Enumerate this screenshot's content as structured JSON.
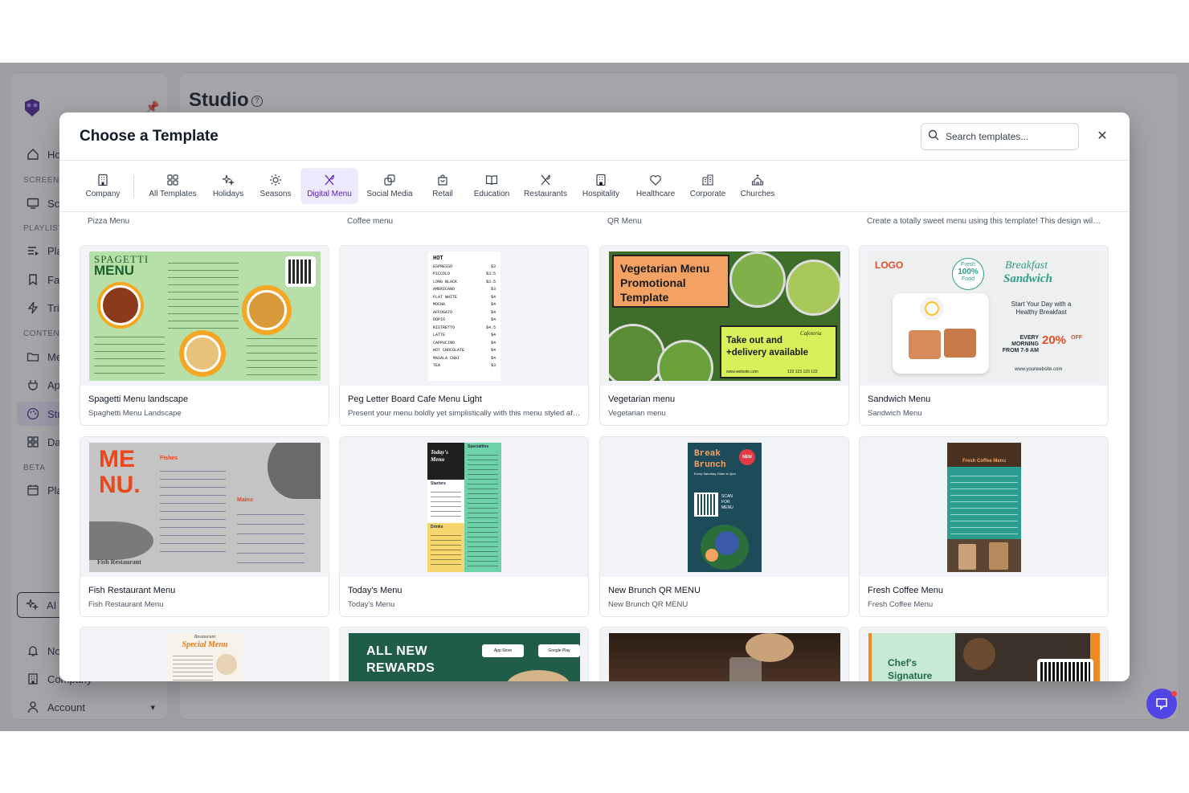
{
  "app": {
    "main_title": "Studio",
    "sidebar": {
      "items": [
        {
          "label": "Home",
          "icon": "home-icon"
        },
        {
          "label": "Screens",
          "icon": "monitor-icon"
        },
        {
          "label": "Playlists",
          "icon": "playlist-icon"
        },
        {
          "label": "Fallback",
          "icon": "bookmark-icon"
        },
        {
          "label": "Triggers",
          "icon": "bolt-icon"
        },
        {
          "label": "Media",
          "icon": "folder-icon"
        },
        {
          "label": "Apps",
          "icon": "plug-icon"
        },
        {
          "label": "Studio",
          "icon": "palette-icon"
        },
        {
          "label": "Dashboards",
          "icon": "grid-icon"
        },
        {
          "label": "Planner",
          "icon": "calendar-icon"
        }
      ],
      "sections": [
        "SCREENS",
        "PLAYLISTS",
        "CONTENT",
        "BETA"
      ],
      "ai_label": "AI",
      "bottom": [
        {
          "label": "Notifications",
          "icon": "bell-icon"
        },
        {
          "label": "Company",
          "icon": "building-icon"
        },
        {
          "label": "Account",
          "icon": "user-icon"
        }
      ]
    }
  },
  "modal": {
    "title": "Choose a Template",
    "search_placeholder": "Search templates...",
    "close_icon": "close-icon",
    "tabs": [
      {
        "label": "Company",
        "icon": "building-icon"
      },
      {
        "label": "All Templates",
        "icon": "grid-icon"
      },
      {
        "label": "Holidays",
        "icon": "sparkles-icon"
      },
      {
        "label": "Seasons",
        "icon": "sun-icon"
      },
      {
        "label": "Digital Menu",
        "icon": "utensils-icon",
        "active": true
      },
      {
        "label": "Social Media",
        "icon": "share-icon"
      },
      {
        "label": "Retail",
        "icon": "shopping-bag-icon"
      },
      {
        "label": "Education",
        "icon": "book-icon"
      },
      {
        "label": "Restaurants",
        "icon": "utensils-icon"
      },
      {
        "label": "Hospitality",
        "icon": "hotel-icon"
      },
      {
        "label": "Healthcare",
        "icon": "heart-icon"
      },
      {
        "label": "Corporate",
        "icon": "office-icon"
      },
      {
        "label": "Churches",
        "icon": "church-icon"
      }
    ],
    "stub_row": [
      "Pizza Menu",
      "Coffee menu",
      "QR Menu",
      "Create a totally sweet menu using this template! This design will bri..."
    ],
    "cards": [
      {
        "title": "Spagetti Menu landscape",
        "subtitle": "Spaghetti Menu Landscape",
        "thumb": {
          "heading1": "SPAGETTI",
          "heading2": "MENU"
        }
      },
      {
        "title": "Peg Letter Board Cafe Menu Light",
        "subtitle": "Present your menu boldly yet simplistically with this menu styled aft...",
        "thumb": {
          "heading": "HOT",
          "items": [
            [
              "ESPRESSO",
              "$3"
            ],
            [
              "PICCOLO",
              "$3.5"
            ],
            [
              "LONG BLACK",
              "$3.5"
            ],
            [
              "AMERICANO",
              "$3"
            ],
            [
              "FLAT WHITE",
              "$4"
            ],
            [
              "MOCHA",
              "$4"
            ],
            [
              "AFFOGATO",
              "$4"
            ],
            [
              "DOPIO",
              "$4"
            ],
            [
              "RISTRETTO",
              "$4.5"
            ],
            [
              "LATTE",
              "$4"
            ],
            [
              "CAPPUCINO",
              "$4"
            ],
            [
              "HOT CHOCOLATE",
              "$4"
            ],
            [
              "MASALA CHAI",
              "$4"
            ],
            [
              "TEA",
              "$3"
            ]
          ]
        }
      },
      {
        "title": "Vegetarian menu",
        "subtitle": "Vegetarian menu",
        "thumb": {
          "heading": "Vegetarian Menu Promotional Template",
          "promo": "Take out and +delivery available",
          "brand": "Cafeteria",
          "website": "www.website.com",
          "phone": "123 123 123 123"
        }
      },
      {
        "title": "Sandwich Menu",
        "subtitle": "Sandwich Menu",
        "thumb": {
          "logo": "LOGO",
          "badge_top": "Fresh",
          "badge_pct": "100%",
          "badge_bottom": "Food",
          "heading1": "Breakfast",
          "heading2": "Sandwich",
          "tagline": "Start Your Day with a Healthy Breakfast",
          "offer1": "EVERY MORNING",
          "offer2": "FROM 7-9 AM",
          "discount": "20%",
          "off": "OFF",
          "website": "www.yourwebsite.com"
        }
      },
      {
        "title": "Fish Restaurant Menu",
        "subtitle": "Fish Restaurant Menu",
        "thumb": {
          "heading1": "ME",
          "heading2": "NU.",
          "section1": "Fishes",
          "section2": "Mains",
          "footer": "Fish Restaurant"
        }
      },
      {
        "title": "Today's Menu",
        "subtitle": "Today's Menu",
        "thumb": {
          "heading": "Today's Menu",
          "s1": "Starters",
          "s2": "Specialties",
          "s3": "Drinks"
        }
      },
      {
        "title": "New Brunch QR MENU",
        "subtitle": "New Brunch QR MENU",
        "thumb": {
          "heading1": "Break",
          "heading2": "Brunch",
          "badge": "NEW",
          "line": "Every Saturday 10am to 4pm",
          "scan": "SCAN FOR MENU"
        }
      },
      {
        "title": "Fresh Coffee Menu",
        "subtitle": "Fresh Coffee Menu",
        "thumb": {
          "heading": "Fresh Coffee Menu"
        }
      },
      {
        "title": "",
        "subtitle": "",
        "thumb": {
          "heading1": "Restaurant",
          "heading2": "Special Menu"
        }
      },
      {
        "title": "",
        "subtitle": "",
        "thumb": {
          "heading1": "ALL NEW",
          "heading2": "REWARDS",
          "store1": "App Store",
          "store2": "Google Play"
        }
      },
      {
        "title": "",
        "subtitle": "",
        "thumb": {}
      },
      {
        "title": "",
        "subtitle": "",
        "thumb": {
          "heading1": "Chef's",
          "heading2": "Signature"
        }
      }
    ]
  },
  "colors": {
    "accent": "#5b21b6",
    "accent_bg": "#ede9fe",
    "overlay": "#3b3b45",
    "chat": "#4f46e5"
  }
}
